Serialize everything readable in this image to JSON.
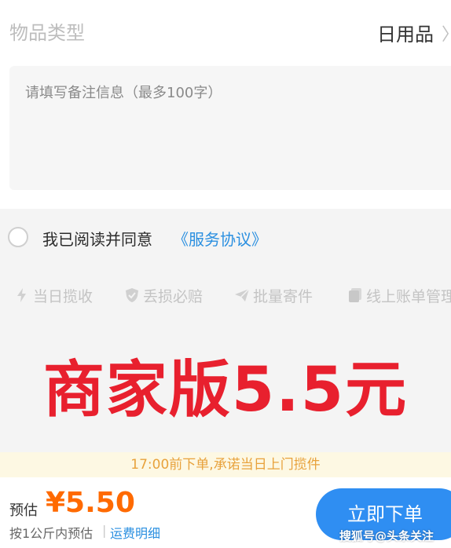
{
  "item_type": {
    "label": "物品类型",
    "value": "日用品",
    "arrow": "〉"
  },
  "remark": {
    "placeholder": "请填写备注信息（最多100字）"
  },
  "agreement": {
    "text": "我已阅读并同意",
    "link": "《服务协议》"
  },
  "features": [
    {
      "label": "当日揽收",
      "icon": "lightning-icon"
    },
    {
      "label": "丢损必赔",
      "icon": "shield-icon"
    },
    {
      "label": "批量寄件",
      "icon": "paper-plane-icon"
    },
    {
      "label": "线上账单管理",
      "icon": "document-icon"
    }
  ],
  "promo": {
    "text": "商家版5.5元",
    "color": "#e8202e"
  },
  "notice": {
    "text": "17:00前下单,承诺当日上门揽件"
  },
  "bottom": {
    "estimate_label": "预估",
    "price": "¥5.50",
    "note": "按1公斤内预估",
    "separator": "|",
    "fee_link": "运费明细",
    "order_button": "立即下单"
  },
  "watermark": "搜狐号@头条关注",
  "colors": {
    "accent_blue": "#2f8ef2",
    "price_orange": "#ff6a00",
    "link_blue": "#2a8fe0"
  }
}
